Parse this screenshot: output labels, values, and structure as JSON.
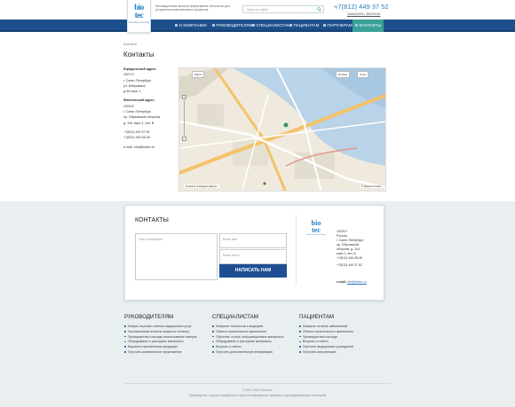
{
  "header": {
    "logo": {
      "line1": "bio",
      "line2": "tec",
      "sub": "biomedical technology"
    },
    "tagline": "Инновационные высокоэ-ффективные технологии для устранения нежелательных процессов",
    "search_placeholder": "Поиск по сайту",
    "phone": "+7(812) 449 37 52",
    "callback": "ЗАКАЗАТЬ ЗВОНОК"
  },
  "nav": {
    "items": [
      "О КОМПАНИИ",
      "РУКОВОДИТЕЛЯМ",
      "СПЕЦИАЛИСТАМ",
      "ПАЦИЕНТАМ",
      "ПАРТНЕРАМ",
      "КОНТАКТЫ"
    ],
    "active": "КОНТАКТЫ"
  },
  "breadcrumb": "Контакты",
  "page_title": "Контакты",
  "address": {
    "legal_label": "Юридический адрес:",
    "legal_lines": [
      "192171",
      "г. Санкт-Петербург",
      "ул. Бабушкина,",
      "д.36 корп. 1"
    ],
    "actual_label": "Фактический адрес:",
    "actual_lines": [
      "192012",
      "г. Санкт-Петербург",
      "пр. Обуховской обороны",
      "д. 116, корп.1, лит. В"
    ],
    "phones": [
      "+7(812) 449 37 52",
      "+7(812) 449-28-36"
    ],
    "email": "e-mail: info@biotec.ru"
  },
  "map": {
    "traffic_btn": "Пробки",
    "layers_btn": "Слои",
    "scale_btn": "Карта",
    "footer": "Открыть в Яндекс.Картах",
    "copyright": "© Яндекс Условия"
  },
  "contact_form": {
    "title": "КОНТАКТЫ",
    "message_placeholder": "Текст сообщения",
    "name_placeholder": "Ваше имя",
    "email_placeholder": "Ваша почта",
    "submit": "НАПИСАТЬ НАМ",
    "address_lines": [
      "192012",
      "Россия,",
      "г. Санкт-Петербург,",
      "пр. Обуховской",
      "обороны, д. 116,",
      "корп.1, лит. В",
      "+7(812) 449-28-36",
      "",
      "+7(812) 449 37 52"
    ],
    "email_label": "e-mail:",
    "email_value": "info@biotec.ru"
  },
  "footer_columns": [
    {
      "title": "РУКОВОДИТЕЛЯМ",
      "items": [
        "Лазеры на рынке платных медицинских услуг",
        "Экономические аспекты лазерного лечения",
        "Преимущества и выгоды использования лазеров",
        "Оборудование и расходные материалы",
        "Варианты приобретения продукции",
        "Получить коммерческое предложение"
      ]
    },
    {
      "title": "СПЕЦИАЛИСТАМ",
      "items": [
        "Лазерные технологии в медицине",
        "Области практического применения",
        "Обучение, статьи, информационные материалы",
        "Оборудование и расходные материалы",
        "Вопросы и ответы",
        "Получить дополнительную информацию"
      ]
    },
    {
      "title": "ПАЦИЕНТАМ",
      "items": [
        "Лазерное лечение заболеваний",
        "Области практического применения",
        "Преимущества и выгоды",
        "Вопросы и ответы",
        "Перечень медицинских учреждений",
        "Получить консультацию"
      ]
    }
  ],
  "copyright": "© 2012–2013 «Биотек»",
  "footer_note": "Производство, научные разработки в сфере инновационных лазерных и фотодинамических технологий"
}
